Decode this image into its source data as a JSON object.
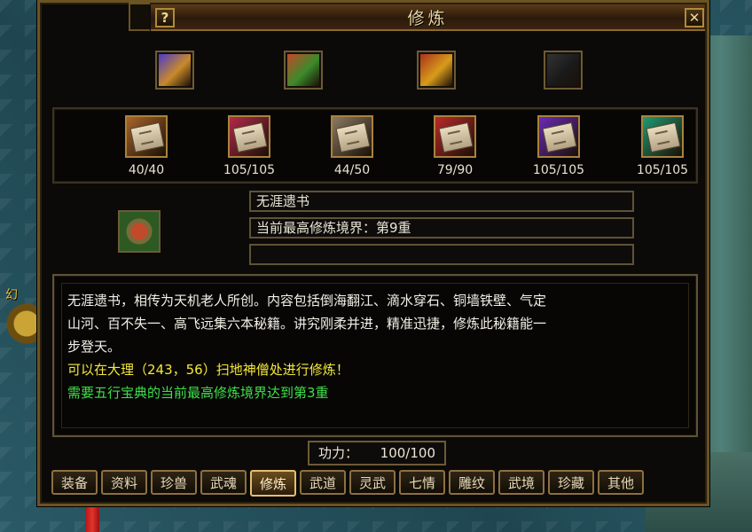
{
  "window": {
    "title": "修炼"
  },
  "background": {
    "left_text": "幻"
  },
  "top_icons": [
    {
      "name": "book-stack-icon",
      "color": "#c98a2a",
      "accent": "#4a3acb"
    },
    {
      "name": "green-scroll-bundle-icon",
      "color": "#3c8a2a",
      "accent": "#c04a2a"
    },
    {
      "name": "gold-treasure-icon",
      "color": "#d89b1a",
      "accent": "#a8321a"
    },
    {
      "name": "empty-slot-icon",
      "color": "#1a1a1a",
      "accent": "#333333"
    }
  ],
  "books": [
    {
      "count": "40/40",
      "color": "#a8642a",
      "icon": "brown-manual-icon"
    },
    {
      "count": "105/105",
      "color": "#b22a4a",
      "icon": "crimson-manual-icon"
    },
    {
      "count": "44/50",
      "color": "#8a7a64",
      "icon": "grey-manual-icon"
    },
    {
      "count": "79/90",
      "color": "#b82a2a",
      "icon": "red-manual-icon"
    },
    {
      "count": "105/105",
      "color": "#6a2ab8",
      "icon": "purple-manual-icon"
    },
    {
      "count": "105/105",
      "color": "#1f9a72",
      "icon": "teal-manual-icon"
    }
  ],
  "info": {
    "name": "无涯遗书",
    "level": "当前最高修炼境界：第9重",
    "extra": ""
  },
  "description": {
    "lines_white": [
      "无涯遗书，相传为天机老人所创。内容包括倒海翻江、滴水穿石、铜墙铁壁、气定",
      "山河、百不失一、高飞远集六本秘籍。讲究刚柔并进，精准迅捷，修炼此秘籍能一",
      "步登天。"
    ],
    "line_yellow": "可以在大理（243，56）扫地神僧处进行修炼！",
    "line_green": "需要五行宝典的当前最高修炼境界达到第3重"
  },
  "gongli": {
    "label": "功力：",
    "value": "100/100"
  },
  "tabs": [
    {
      "label": "装备",
      "active": false
    },
    {
      "label": "资料",
      "active": false
    },
    {
      "label": "珍兽",
      "active": false
    },
    {
      "label": "武魂",
      "active": false
    },
    {
      "label": "修炼",
      "active": true
    },
    {
      "label": "武道",
      "active": false
    },
    {
      "label": "灵武",
      "active": false
    },
    {
      "label": "七情",
      "active": false
    },
    {
      "label": "雕纹",
      "active": false
    },
    {
      "label": "武境",
      "active": false
    },
    {
      "label": "珍藏",
      "active": false
    },
    {
      "label": "其他",
      "active": false
    }
  ]
}
